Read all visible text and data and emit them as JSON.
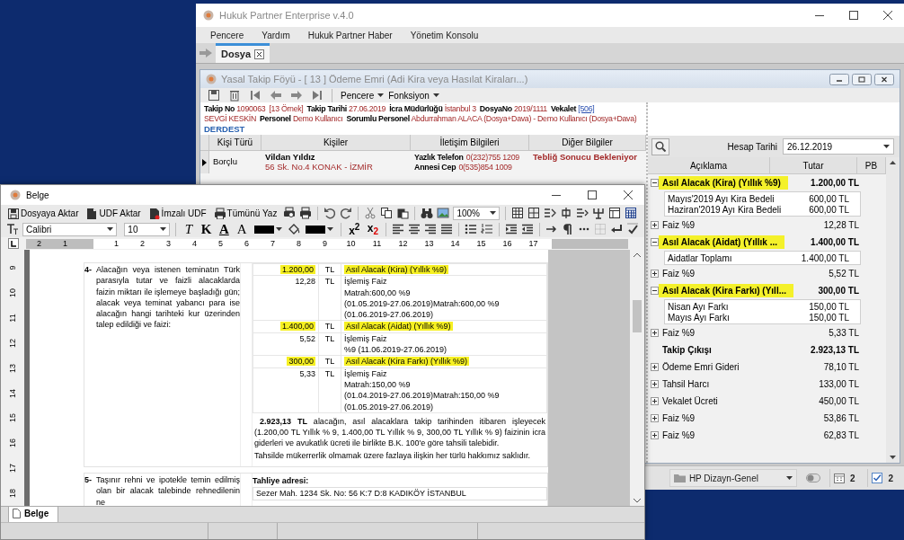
{
  "main_window": {
    "title": "Hukuk Partner Enterprise v.4.0",
    "menu": [
      "Pencere",
      "Yardım",
      "Hukuk Partner Haber",
      "Yönetim Konsolu"
    ],
    "tabs": [
      {
        "label": "Dosya",
        "selected": true
      }
    ]
  },
  "case_window": {
    "title": "Yasal Takip Föyü - [ 13 ] Ödeme Emri (Adi Kira veya Hasılat Kiraları...)",
    "toolbar_menus": [
      "Pencere",
      "Fonksiyon"
    ],
    "info_lines": [
      [
        {
          "label": "Takip No",
          "value": "1090063",
          "kind": "value"
        },
        {
          "value": "[13 Örnek]",
          "kind": "value"
        },
        {
          "label": "Takip Tarihi",
          "value": "27.06.2019",
          "kind": "value"
        },
        {
          "label": "İcra Müdürlüğü",
          "value": "İstanbul 3",
          "kind": "value"
        },
        {
          "label": "DosyaNo",
          "value": "2019/1111",
          "kind": "value"
        },
        {
          "label": "Vekalet",
          "value": "[506]",
          "kind": "link"
        }
      ],
      [
        {
          "value": "SEVGİ KESKİN",
          "kind": "value"
        },
        {
          "label": "Personel",
          "value": "Demo Kullanıcı",
          "kind": "value"
        },
        {
          "label": "Sorumlu Personel",
          "value": "Abdurrahman ALACA (Dosya+Dava) - Demo Kullanıcı (Dosya+Dava)",
          "kind": "value"
        }
      ]
    ],
    "status": "DERDEST",
    "parties": {
      "columns": [
        "Kişi Türü",
        "Kişiler",
        "İletişim Bilgileri",
        "Diğer Bilgiler"
      ],
      "rows": [
        {
          "selected": true,
          "type": "Borçlu",
          "name": "Vildan Yıldız",
          "address": "56 Sk. No.4  KONAK - İZMİR",
          "contacts": [
            {
              "label": "Yazlık Telefon",
              "value": "0(232)755 1209"
            },
            {
              "label": "Annesi Cep",
              "value": "0(535)854 1009"
            }
          ],
          "other": "Tebliğ Sonucu Bekleniyor"
        }
      ]
    }
  },
  "account": {
    "date_label": "Hesap Tarihi",
    "date": "26.12.2019",
    "columns": [
      "Açıklama",
      "Tutar",
      "PB"
    ],
    "rows": [
      {
        "kind": "group",
        "label": "Asıl Alacak (Kira) (Yıllık %9)",
        "amount": "1.200,00 TL",
        "expanded": true,
        "highlighted": true,
        "children": [
          {
            "label": "Mayıs'2019 Ayı Kira Bedeli",
            "amount": "600,00 TL"
          },
          {
            "label": "Haziran'2019 Ayı Kira Bedeli",
            "amount": "600,00 TL"
          }
        ]
      },
      {
        "kind": "item",
        "label": "Faiz  %9",
        "amount": "12,28 TL",
        "expanded": false
      },
      {
        "kind": "group",
        "label": "Asıl Alacak (Aidat) (Yıllık ...",
        "amount": "1.400,00 TL",
        "expanded": true,
        "highlighted": true,
        "children": [
          {
            "label": "Aidatlar Toplamı",
            "amount": "1.400,00 TL"
          }
        ]
      },
      {
        "kind": "item",
        "label": "Faiz  %9",
        "amount": "5,52 TL",
        "expanded": false
      },
      {
        "kind": "group",
        "label": "Asıl Alacak (Kira Farkı) (Yıll...",
        "amount": "300,00 TL",
        "expanded": true,
        "highlighted": true,
        "children": [
          {
            "label": "Nisan Ayı Farkı",
            "amount": "150,00 TL"
          },
          {
            "label": "Mayıs Ayı Farkı",
            "amount": "150,00 TL"
          }
        ]
      },
      {
        "kind": "item",
        "label": "Faiz  %9",
        "amount": "5,33 TL",
        "expanded": false
      },
      {
        "kind": "total",
        "label": "Takip Çıkışı",
        "amount": "2.923,13 TL"
      },
      {
        "kind": "item",
        "label": "Ödeme Emri Gideri",
        "amount": "78,10 TL",
        "expanded": false
      },
      {
        "kind": "item",
        "label": "Tahsil Harcı",
        "amount": "133,00 TL",
        "expanded": false
      },
      {
        "kind": "item",
        "label": "Vekalet Ücreti",
        "amount": "450,00 TL",
        "expanded": false
      },
      {
        "kind": "item",
        "label": "Faiz  %9",
        "amount": "53,86 TL",
        "expanded": false
      },
      {
        "kind": "item",
        "label": "Faiz  %9",
        "amount": "62,83 TL",
        "expanded": false
      }
    ]
  },
  "status_bar": {
    "layout": "HP Dizayn-Genel",
    "counters": [
      "2",
      "2"
    ]
  },
  "document_window": {
    "title": "Belge",
    "actions": [
      "Dosyaya Aktar",
      "UDF Aktar",
      "İmzalı UDF",
      "Tümünü Yaz"
    ],
    "zoom": "100%",
    "font": "Calibri",
    "size": "10",
    "format_buttons": [
      {
        "kind": "italic",
        "glyph": "T"
      },
      {
        "kind": "bold",
        "glyph": "K"
      },
      {
        "kind": "underline",
        "glyph": "A"
      },
      {
        "kind": "font-color",
        "glyph": "A"
      }
    ],
    "script_buttons": [
      {
        "kind": "superscript",
        "glyph": "x$^{2}$"
      },
      {
        "kind": "subscript",
        "glyph": "x$_{2}$"
      }
    ],
    "ruler": [
      "2",
      "1",
      "1",
      "2",
      "3",
      "4",
      "5",
      "6",
      "7",
      "8",
      "9",
      "10",
      "11",
      "12",
      "13",
      "14",
      "15",
      "16",
      "17"
    ],
    "vertical_ruler": [
      "9",
      "10",
      "11",
      "12",
      "13",
      "14",
      "15",
      "16",
      "17",
      "18"
    ],
    "items": [
      {
        "number": "4-",
        "text": "Alacağın veya istenen teminatın Türk parasıyla tutar ve faizli alacaklarda faizin miktarı ile işlemeye başladığı gün; alacak veya teminat yabancı para ise alacağın hangi tarihteki kur üzerinden talep edildiği ve faizi:",
        "claims": [
          {
            "amount": "1.200,00",
            "currency": "TL",
            "lines": [
              "Asıl Alacak (Kira) (Yıllık %9)"
            ],
            "highlighted": true
          },
          {
            "amount": "12,28",
            "currency": "TL",
            "lines": [
              "İşlemiş Faiz",
              "Matrah:600,00 %9",
              "(01.05.2019-27.06.2019)Matrah:600,00 %9",
              "(01.06.2019-27.06.2019)"
            ],
            "highlighted": false
          },
          {
            "amount": "1.400,00",
            "currency": "TL",
            "lines": [
              "Asıl Alacak (Aidat) (Yıllık %9)"
            ],
            "highlighted": true
          },
          {
            "amount": "5,52",
            "currency": "TL",
            "lines": [
              "İşlemiş Faiz",
              "%9 (11.06.2019-27.06.2019)"
            ],
            "highlighted": false
          },
          {
            "amount": "300,00",
            "currency": "TL",
            "lines": [
              "Asıl Alacak (Kira Farkı) (Yıllık %9)"
            ],
            "highlighted": true
          },
          {
            "amount": "5,33",
            "currency": "TL",
            "lines": [
              "İşlemiş Faiz",
              "Matrah:150,00 %9",
              "(01.04.2019-27.06.2019)Matrah:150,00 %9",
              "(01.05.2019-27.06.2019)"
            ],
            "highlighted": false
          }
        ],
        "summary": [
          "**2.923,13 TL** alacağın, asıl alacaklara takip tarihinden itibaren işleyecek (1.200,00 TL Yıllık % 9, 1.400,00 TL Yıllık % 9, 300,00 TL Yıllık % 9) faizinin  icra giderleri ve avukatlık ücreti ile birlikte B.K. 100'e göre tahsili talebidir.",
          "Tahsilde mükerrerlik olmamak üzere fazlaya ilişkin her türlü hakkımız saklıdır."
        ]
      },
      {
        "number": "5-",
        "text": "Taşınır rehni ve ipotekle temin edilmiş olan bir alacak talebinde rehnedilenin ne",
        "detail_title": "Tahliye adresi:",
        "detail": "Sezer Mah. 1234 Sk. No: 56 K:7 D:8 KADIKÖY İSTANBUL"
      }
    ],
    "tabs": [
      {
        "label": "Belge",
        "selected": true
      }
    ]
  }
}
